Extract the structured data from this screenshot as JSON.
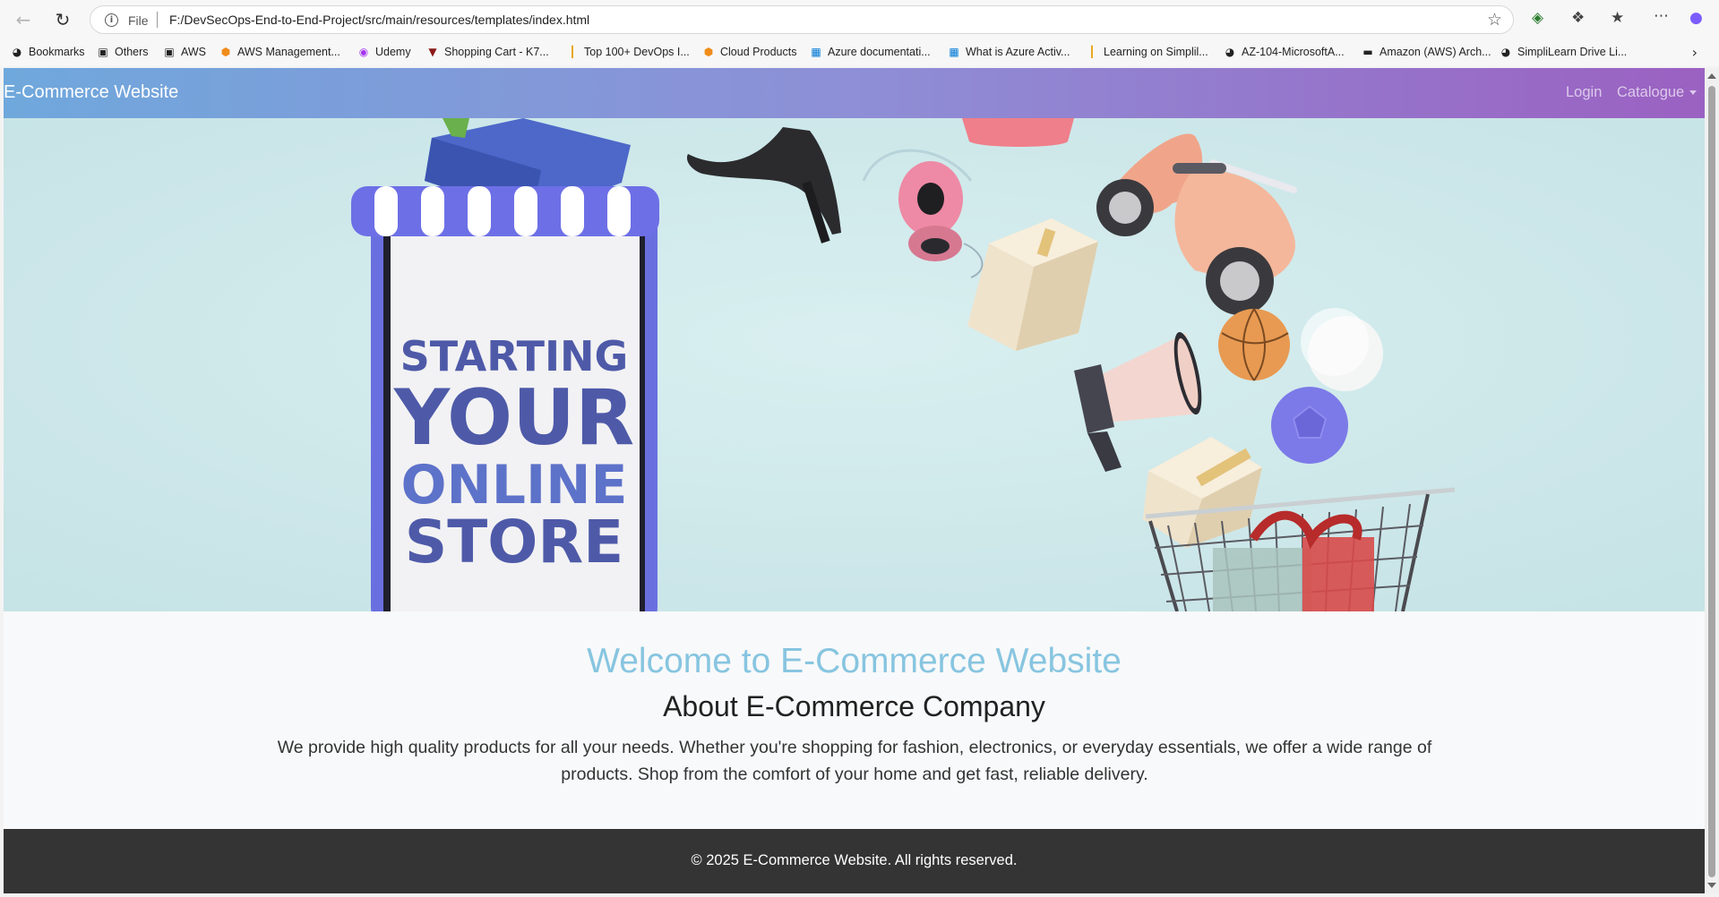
{
  "browser": {
    "address": {
      "file_label": "File",
      "url": "F:/DevSecOps-End-to-End-Project/src/main/resources/templates/index.html"
    },
    "bookmarks": [
      {
        "label": "Bookmarks",
        "icon": "globe-icon"
      },
      {
        "label": "Others",
        "icon": "folder-icon"
      },
      {
        "label": "AWS",
        "icon": "folder-icon"
      },
      {
        "label": "AWS Management...",
        "icon": "aws-cube-icon"
      },
      {
        "label": "Udemy",
        "icon": "udemy-icon"
      },
      {
        "label": "Shopping Cart - K7...",
        "icon": "vue-icon"
      },
      {
        "label": "Top 100+ DevOps I...",
        "icon": "bar-icon"
      },
      {
        "label": "Cloud Products",
        "icon": "aws-cube-icon"
      },
      {
        "label": "Azure documentati...",
        "icon": "microsoft-icon"
      },
      {
        "label": "What is Azure Activ...",
        "icon": "microsoft-icon"
      },
      {
        "label": "Learning on Simplil...",
        "icon": "simplilearn-icon"
      },
      {
        "label": "AZ-104-MicrosoftA...",
        "icon": "globe-icon"
      },
      {
        "label": "Amazon (AWS) Arch...",
        "icon": "dash-icon"
      },
      {
        "label": "SimpliLearn Drive Li...",
        "icon": "globe-icon"
      }
    ]
  },
  "site": {
    "brand": "E-Commerce Website",
    "nav": {
      "login": "Login",
      "catalogue": "Catalogue"
    },
    "hero": {
      "line1": "STARTING",
      "line2": "YOUR",
      "line3": "ONLINE",
      "line4": "STORE"
    },
    "welcome": "Welcome to E-Commerce Website",
    "about_title": "About E-Commerce Company",
    "about_text": "We provide high quality products for all your needs. Whether you're shopping for fashion, electronics, or everyday essentials, we offer a wide range of products. Shop from the comfort of your home and get fast, reliable delivery.",
    "footer": "© 2025 E-Commerce Website. All rights reserved."
  },
  "colors": {
    "navbar_start": "#6fa8dc",
    "navbar_end": "#9b61c2",
    "welcome": "#87c5e0",
    "footer_bg": "#343434",
    "hero_bg": "#cfe8ea",
    "store_text": "#4e5aa8"
  }
}
